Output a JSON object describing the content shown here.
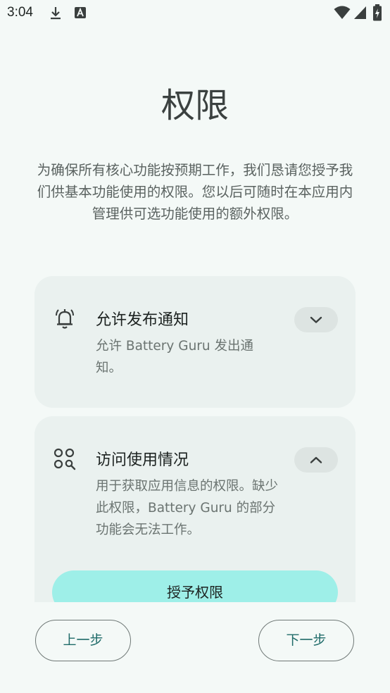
{
  "status_bar": {
    "time": "3:04",
    "icons": [
      "download-icon",
      "keyboard-a-icon",
      "wifi-icon",
      "signal-icon",
      "battery-charging-icon"
    ]
  },
  "page": {
    "title": "权限",
    "intro": "为确保所有核心功能按预期工作，我们恳请您授予我们供基本功能使用的权限。您以后可随时在本应用内管理供可选功能使用的额外权限。"
  },
  "permissions": [
    {
      "icon": "bell-ringing-icon",
      "title": "允许发布通知",
      "description": "允许 Battery Guru 发出通知。",
      "expanded": false,
      "toggle_icon": "chevron-down-icon"
    },
    {
      "icon": "apps-search-icon",
      "title": "访问使用情况",
      "description": "用于获取应用信息的权限。缺少此权限，Battery Guru 的部分功能会无法工作。",
      "expanded": true,
      "toggle_icon": "chevron-up-icon",
      "grant_label": "授予权限"
    }
  ],
  "navigation": {
    "prev_label": "上一步",
    "next_label": "下一步"
  },
  "colors": {
    "background": "#f4f9f7",
    "card": "#eaf1ef",
    "grant_button": "#9eefe8",
    "nav_text": "#1f6b69"
  }
}
